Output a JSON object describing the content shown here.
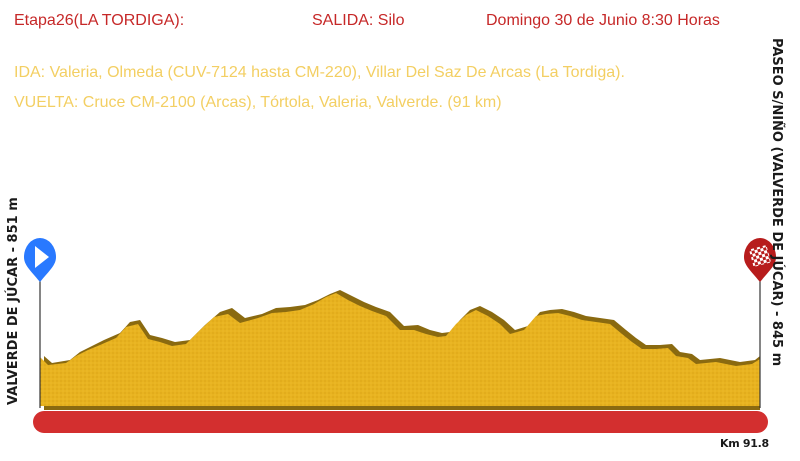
{
  "header": {
    "stage_title": "Etapa26(LA TORDIGA):",
    "start_info": "SALIDA: Silo",
    "date_info": "Domingo 30 de Junio 8:30 Horas"
  },
  "route": {
    "ida": "IDA: Valeria, Olmeda (CUV-7124 hasta CM-220), Villar Del Saz De Arcas (La Tordiga).",
    "vuelta": "VUELTA: Cruce CM-2100 (Arcas), Tórtola, Valeria, Valverde. (91 km)"
  },
  "profile": {
    "start_label": "VALVERDE DE JÚCAR - 851 m",
    "end_label": "PASEO S/NIÑO (VALVERDE DE JÚCAR) - 845 m",
    "distance_label": "Km 91.8",
    "start_marker_icon": "play-arrow-icon",
    "finish_marker_icon": "checkered-flag-icon",
    "colors": {
      "terrain": "#e8b320",
      "terrain_shadow": "#8a6a10",
      "distance_bar": "#d32f2f",
      "start_marker": "#2979ff",
      "finish_marker": "#b71c1c",
      "title_text": "#c62828",
      "route_text": "#f3cf63"
    }
  }
}
